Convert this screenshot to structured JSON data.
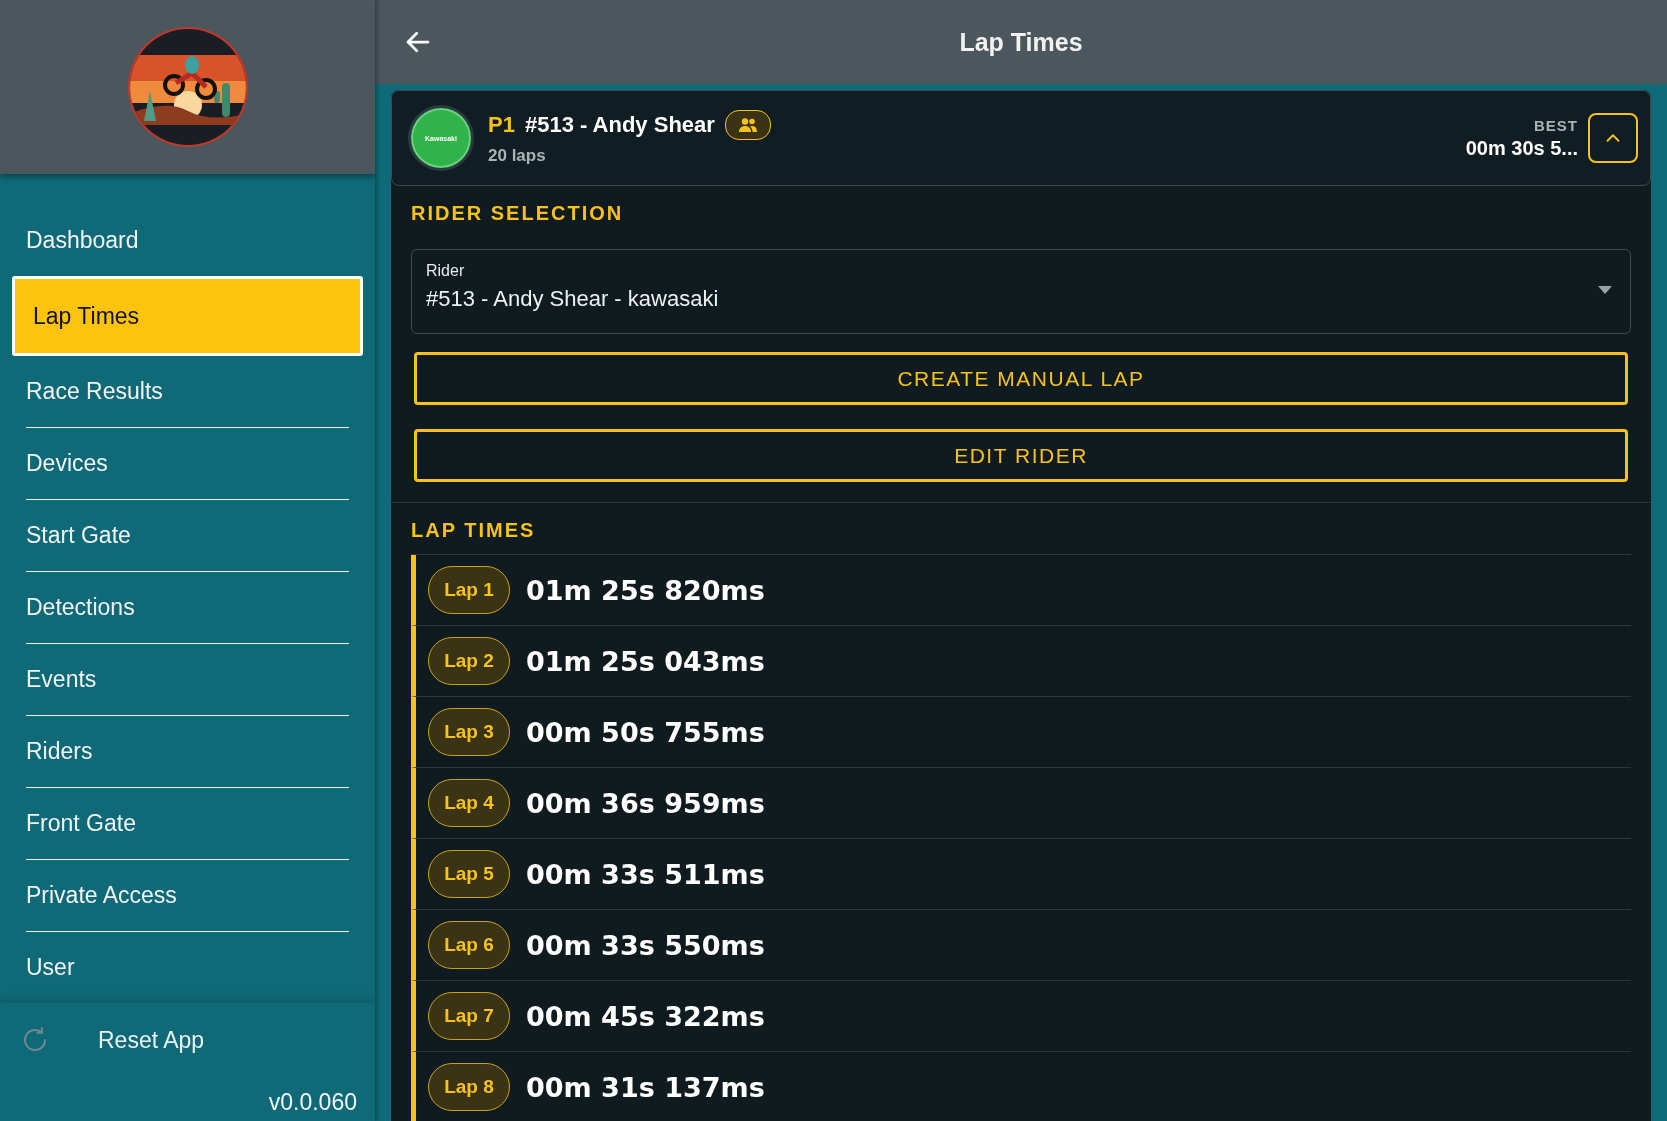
{
  "sidebar": {
    "nav_items": [
      {
        "label": "Dashboard",
        "selected": false
      },
      {
        "label": "Lap Times",
        "selected": true
      },
      {
        "label": "Race Results",
        "selected": false
      },
      {
        "label": "Devices",
        "selected": false
      },
      {
        "label": "Start Gate",
        "selected": false
      },
      {
        "label": "Detections",
        "selected": false
      },
      {
        "label": "Events",
        "selected": false
      },
      {
        "label": "Riders",
        "selected": false
      },
      {
        "label": "Front Gate",
        "selected": false
      },
      {
        "label": "Private Access",
        "selected": false
      },
      {
        "label": "User",
        "selected": false
      }
    ],
    "footer": {
      "reset_label": "Reset App",
      "version": "v0.0.060"
    }
  },
  "header": {
    "title": "Lap Times"
  },
  "rider_card": {
    "position": "P1",
    "name": "#513 - Andy Shear",
    "brand_badge": "Kawasaki",
    "laps": "20 laps",
    "best_label": "BEST",
    "best_time": "00m 30s 5...",
    "expanded": true
  },
  "rider_selection": {
    "heading": "RIDER SELECTION",
    "field_label": "Rider",
    "field_value": "#513 - Andy Shear - kawasaki",
    "buttons": [
      "CREATE MANUAL LAP",
      "EDIT RIDER"
    ]
  },
  "lap_times": {
    "heading": "LAP TIMES",
    "laps": [
      {
        "label": "Lap 1",
        "time": "01m 25s 820ms"
      },
      {
        "label": "Lap 2",
        "time": "01m 25s 043ms"
      },
      {
        "label": "Lap 3",
        "time": "00m 50s 755ms"
      },
      {
        "label": "Lap 4",
        "time": "00m 36s 959ms"
      },
      {
        "label": "Lap 5",
        "time": "00m 33s 511ms"
      },
      {
        "label": "Lap 6",
        "time": "00m 33s 550ms"
      },
      {
        "label": "Lap 7",
        "time": "00m 45s 322ms"
      },
      {
        "label": "Lap 8",
        "time": "00m 31s 137ms"
      }
    ]
  }
}
